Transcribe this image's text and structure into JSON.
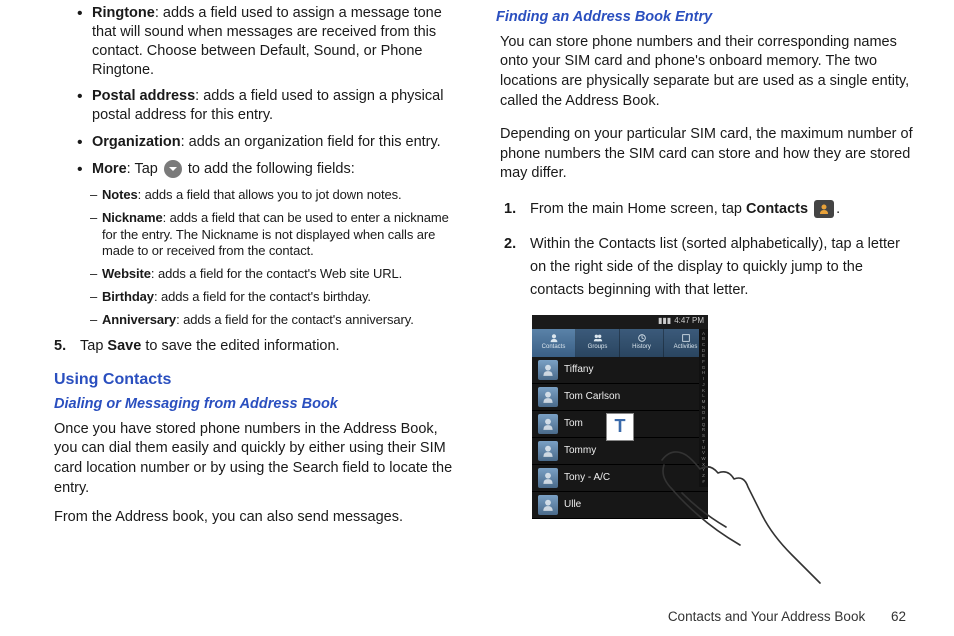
{
  "left": {
    "bullets": [
      {
        "term": "Ringtone",
        "desc": ": adds a field used to assign a message tone that will sound when messages are received from this contact. Choose between Default, Sound, or Phone Ringtone."
      },
      {
        "term": "Postal address",
        "desc": ": adds a field used to assign a physical postal address for this entry."
      },
      {
        "term": "Organization",
        "desc": ": adds an organization field for this entry."
      },
      {
        "term": "More",
        "desc_prefix": ": Tap ",
        "desc_suffix": " to add the following fields:"
      }
    ],
    "sub": [
      {
        "term": "Notes",
        "desc": ": adds a field that allows you to jot down notes."
      },
      {
        "term": "Nickname",
        "desc": ": adds a field that can be used to enter a nickname for the entry. The Nickname is not displayed when calls are made to or received from the contact."
      },
      {
        "term": "Website",
        "desc": ": adds a field for the contact's Web site URL."
      },
      {
        "term": "Birthday",
        "desc": ": adds a field for the contact's birthday."
      },
      {
        "term": "Anniversary",
        "desc": ": adds a field for the contact's anniversary."
      }
    ],
    "step5": {
      "num": "5.",
      "pre": "Tap ",
      "bold": "Save",
      "post": " to save the edited information."
    },
    "h2": "Using Contacts",
    "h3": "Dialing or Messaging from Address Book",
    "p1": "Once you have stored phone numbers in the Address Book, you can dial them easily and quickly by either using their SIM card location number or by using the Search field to locate the entry.",
    "p2": "From the Address book, you can also send messages."
  },
  "right": {
    "h3": "Finding an Address Book Entry",
    "p1": "You can store phone numbers and their corresponding names onto your SIM card and phone's onboard memory. The two locations are physically separate but are used as a single entity, called the Address Book.",
    "p2": "Depending on your particular SIM card, the maximum number of phone numbers the SIM card can store and how they are stored may differ.",
    "step1": {
      "num": "1.",
      "pre": "From the main Home screen, tap ",
      "bold": "Contacts",
      "post": " "
    },
    "step2": {
      "num": "2.",
      "text": "Within the Contacts list (sorted alphabetically), tap a letter on the right side of the display to quickly jump to the contacts beginning with that letter."
    },
    "phone": {
      "status_time": "4:47 PM",
      "tabs": [
        "Contacts",
        "Groups",
        "History",
        "Activities"
      ],
      "rows": [
        "Tiffany",
        "Tom Carlson",
        "Tom",
        "Tommy",
        "Tony - A/C",
        "Ulle"
      ],
      "popup": "T",
      "alpha": "ABCDEFGHIJKLMNOPQRSTUVWXYZ#"
    }
  },
  "footer": {
    "section": "Contacts and Your Address Book",
    "page": "62"
  }
}
